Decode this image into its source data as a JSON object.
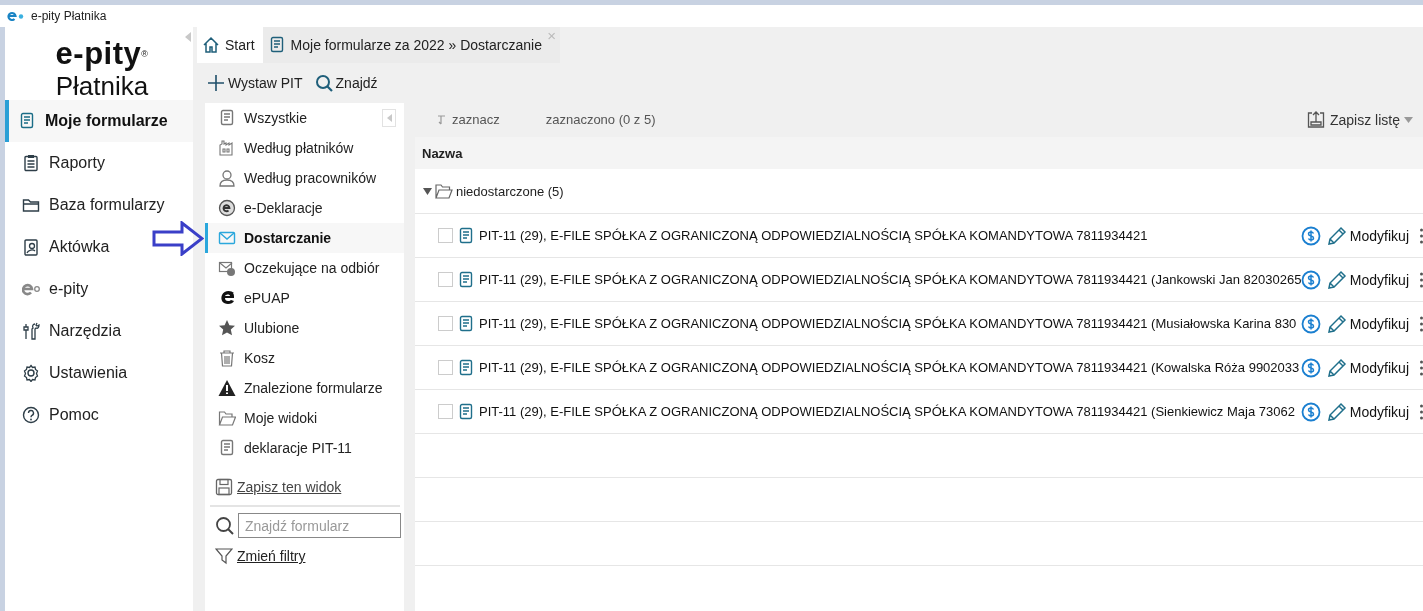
{
  "window": {
    "title": "e-pity Płatnika"
  },
  "logo": {
    "brand": "e-pity",
    "mark": "®",
    "subtitle": "Płatnika"
  },
  "sidebar": {
    "items": [
      {
        "label": "Moje formularze",
        "selected": true
      },
      {
        "label": "Raporty",
        "selected": false
      },
      {
        "label": "Baza formularzy",
        "selected": false
      },
      {
        "label": "Aktówka",
        "selected": false
      },
      {
        "label": "e-pity",
        "selected": false
      },
      {
        "label": "Narzędzia",
        "selected": false
      },
      {
        "label": "Ustawienia",
        "selected": false
      },
      {
        "label": "Pomoc",
        "selected": false
      }
    ]
  },
  "tabs": [
    {
      "label": "Start",
      "selected": false
    },
    {
      "label": "Moje formularze za 2022 » Dostarczanie",
      "selected": true,
      "close": "×"
    }
  ],
  "toolbar": {
    "buttons": [
      "Wystaw PIT",
      "Znajdź"
    ]
  },
  "filters": {
    "items": [
      {
        "label": "Wszystkie",
        "selected": false
      },
      {
        "label": "Według płatników",
        "selected": false
      },
      {
        "label": "Według pracowników",
        "selected": false
      },
      {
        "label": "e-Deklaracje",
        "selected": false
      },
      {
        "label": "Dostarczanie",
        "selected": true
      },
      {
        "label": "Oczekujące na odbiór",
        "selected": false
      },
      {
        "label": "ePUAP",
        "selected": false
      },
      {
        "label": "Ulubione",
        "selected": false
      },
      {
        "label": "Kosz",
        "selected": false
      },
      {
        "label": "Znalezione formularze",
        "selected": false
      },
      {
        "label": "Moje widoki",
        "selected": false
      },
      {
        "label": "deklaracje PIT-11",
        "selected": false
      }
    ],
    "save_view": "Zapisz ten widok",
    "search": {
      "placeholder": "Znajdź formularz"
    },
    "change_filters": "Zmień filtry"
  },
  "list": {
    "select": "zaznacz",
    "selected_count": "zaznaczono (0 z 5)",
    "save_list": "Zapisz listę",
    "columns": [
      "Nazwa"
    ],
    "group": {
      "label": "niedostarczone (5)",
      "expanded": true
    },
    "rows": [
      {
        "name": "PIT-11 (29), E-FILE SPÓŁKA Z OGRANICZONĄ ODPOWIEDZIALNOŚCIĄ SPÓŁKA KOMANDYTOWA 7811934421",
        "checked": false,
        "action": "Modyfikuj"
      },
      {
        "name": "PIT-11 (29), E-FILE SPÓŁKA Z OGRANICZONĄ ODPOWIEDZIALNOŚCIĄ SPÓŁKA KOMANDYTOWA 7811934421 (Jankowski Jan 82030265",
        "checked": false,
        "action": "Modyfikuj"
      },
      {
        "name": "PIT-11 (29), E-FILE SPÓŁKA Z OGRANICZONĄ ODPOWIEDZIALNOŚCIĄ SPÓŁKA KOMANDYTOWA 7811934421 (Musiałowska Karina 830",
        "checked": false,
        "action": "Modyfikuj"
      },
      {
        "name": "PIT-11 (29), E-FILE SPÓŁKA Z OGRANICZONĄ ODPOWIEDZIALNOŚCIĄ SPÓŁKA KOMANDYTOWA 7811934421 (Kowalska Róża 9902033",
        "checked": false,
        "action": "Modyfikuj"
      },
      {
        "name": "PIT-11 (29), E-FILE SPÓŁKA Z OGRANICZONĄ ODPOWIEDZIALNOŚCIĄ SPÓŁKA KOMANDYTOWA 7811934421 (Sienkiewicz Maja 73062",
        "checked": false,
        "action": "Modyfikuj"
      }
    ]
  }
}
